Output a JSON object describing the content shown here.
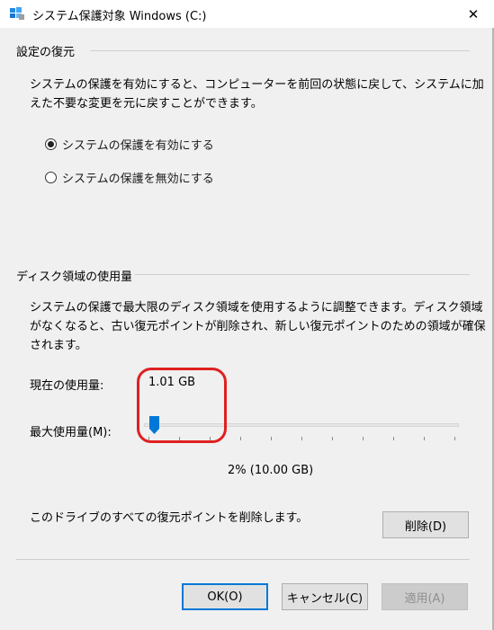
{
  "window": {
    "title": "システム保護対象 Windows (C:)",
    "close_glyph": "✕",
    "icon": "computer-shield-icon"
  },
  "restore_settings": {
    "group_title": "設定の復元",
    "description_line1": "システムの保護を有効にすると、コンピューターを前回の状態に戻して、システムに加",
    "description_line2": "えた不要な変更を元に戻すことができます。",
    "options": [
      {
        "label": "システムの保護を有効にする",
        "checked": true
      },
      {
        "label": "システムの保護を無効にする",
        "checked": false
      }
    ]
  },
  "disk_usage": {
    "group_title": "ディスク領域の使用量",
    "description_line1": "システムの保護で最大限のディスク領域を使用するように調整できます。ディスク領域",
    "description_line2": "がなくなると、古い復元ポイントが削除され、新しい復元ポイントのための領域が確保",
    "description_line3": "されます。",
    "current_usage_label": "現在の使用量:",
    "current_usage_value": "1.01 GB",
    "max_usage_label": "最大使用量(M):",
    "max_usage_percent": 2,
    "max_usage_display": "2% (10.00 GB)",
    "delete_description": "このドライブのすべての復元ポイントを削除します。",
    "delete_button": "削除(D)"
  },
  "footer": {
    "ok_button": "OK(O)",
    "cancel_button": "キャンセル(C)",
    "apply_button": "適用(A)"
  },
  "colors": {
    "accent": "#0078d7",
    "annotation": "#e02020"
  }
}
